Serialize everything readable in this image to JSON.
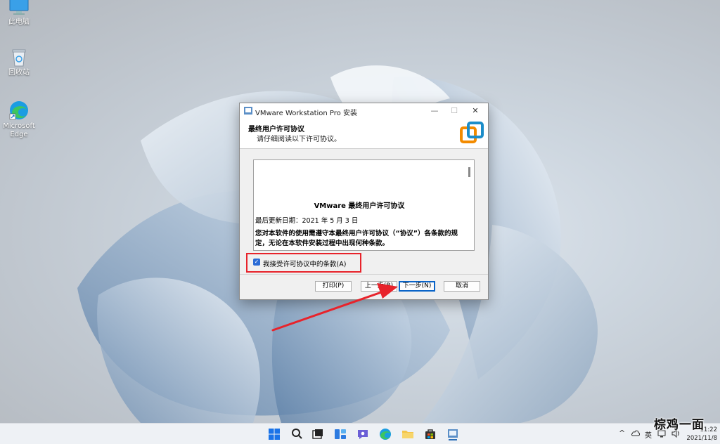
{
  "desktop": {
    "icons": [
      {
        "name": "此电脑",
        "icon": "computer-icon"
      },
      {
        "name": "回收站",
        "icon": "recycle-bin-icon"
      },
      {
        "name_line1": "Microsoft",
        "name_line2": "Edge",
        "icon": "edge-icon"
      }
    ]
  },
  "dialog": {
    "title": "VMware Workstation Pro 安装",
    "minimize_glyph": "—",
    "maximize_glyph": "☐",
    "close_glyph": "✕",
    "header_title": "最终用户许可协议",
    "header_subtitle": "请仔细阅读以下许可协议。",
    "license": {
      "heading": "VMware 最终用户许可协议",
      "updated": "最后更新日期：2021 年 5 月 3 日",
      "paragraph": "您对本软件的使用需遵守本最终用户许可协议（“协议”）各条款的规定，无论在本软件安装过程中出现何种条款。"
    },
    "accept_label": "我接受许可协议中的条款(A)",
    "accept_checked": true,
    "buttons": {
      "print": "打印(P)",
      "back": "上一步(B)",
      "next": "下一步(N)",
      "cancel": "取消"
    }
  },
  "colors": {
    "highlight_box": "#e8232b",
    "arrow": "#e8232b",
    "accent": "#2b6bd6",
    "vmware_orange": "#f38b00",
    "vmware_blue": "#1c8dc9"
  },
  "taskbar": {
    "icons": [
      "start-icon",
      "search-icon",
      "task-view-icon",
      "widgets-icon",
      "chat-icon",
      "edge-icon",
      "file-explorer-icon",
      "store-icon",
      "vmware-installer-icon"
    ],
    "tray": {
      "chevron": "^",
      "language": "英",
      "time": "11:22",
      "date": "2021/11/8"
    }
  },
  "watermark": "棕鸡一面"
}
